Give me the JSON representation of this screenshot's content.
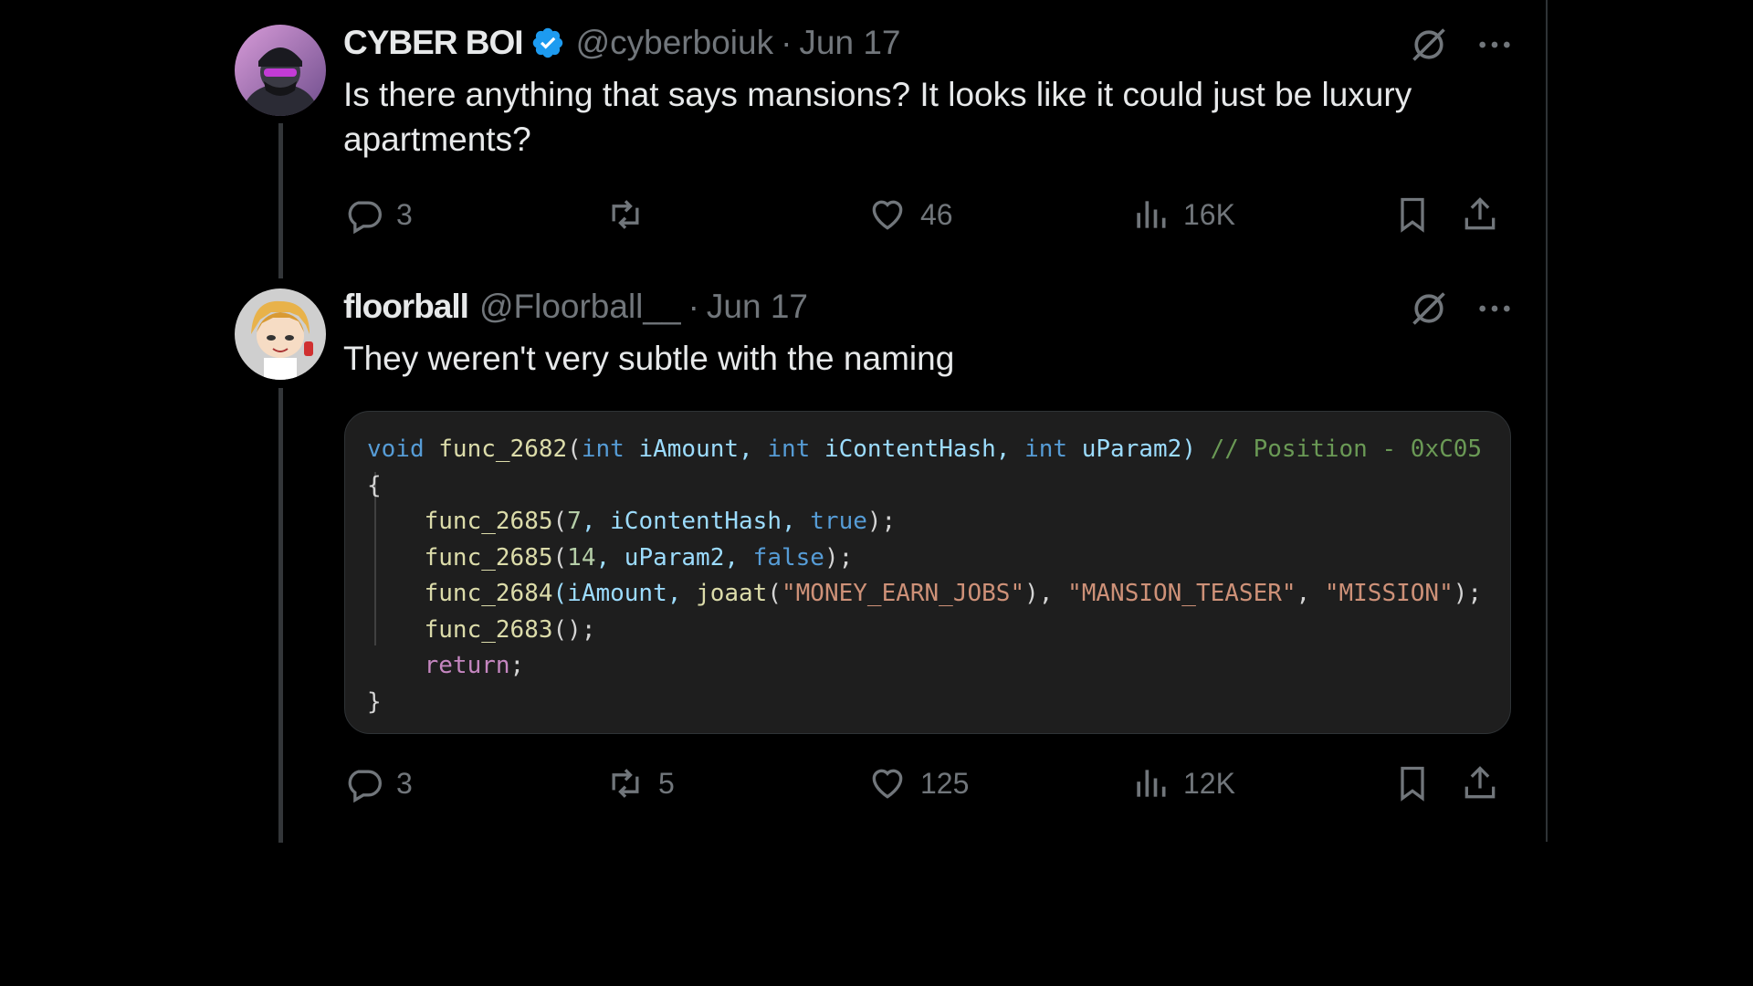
{
  "tweets": [
    {
      "name": "CYBER BOI",
      "handle": "@cyberboiuk",
      "separator": "·",
      "date": "Jun 17",
      "text": "Is there anything that says mansions? It looks like it could just be luxury apartments?",
      "replies": "3",
      "retweets": "",
      "likes": "46",
      "views": "16K",
      "verified": true
    },
    {
      "name": "floorball",
      "handle": "@Floorball__",
      "separator": "·",
      "date": "Jun 17",
      "text": "They weren't very subtle with the naming",
      "replies": "3",
      "retweets": "5",
      "likes": "125",
      "views": "12K",
      "verified": false,
      "code": {
        "l1": {
          "kw_void": "void",
          "fn": "func_2682",
          "p1": "(",
          "kw_int1": "int",
          "v1": " iAmount, ",
          "kw_int2": "int",
          "v2": " iContentHash, ",
          "kw_int3": "int",
          "v3": " uParam2) ",
          "comment": "// Position - 0xC05"
        },
        "l2": "{",
        "l3": {
          "fn": "func_2685",
          "a": "(",
          "n": "7",
          "b": ", iContentHash, ",
          "kw": "true",
          "c": ");"
        },
        "l4": {
          "fn": "func_2685",
          "a": "(",
          "n": "14",
          "b": ", uParam2, ",
          "kw": "false",
          "c": ");"
        },
        "l5": {
          "fn": "func_2684",
          "a": "(iAmount, ",
          "fn2": "joaat",
          "b": "(",
          "s1": "\"MONEY_EARN_JOBS\"",
          "c": "), ",
          "s2": "\"MANSION_TEASER\"",
          "d": ", ",
          "s3": "\"MISSION\"",
          "e": ");"
        },
        "l6": {
          "fn": "func_2683",
          "a": "();"
        },
        "l7": {
          "kw": "return",
          "a": ";"
        },
        "l8": "}"
      }
    }
  ],
  "icons": [
    "grok-icon",
    "more-icon",
    "reply-icon",
    "retweet-icon",
    "like-icon",
    "views-icon",
    "bookmark-icon",
    "share-icon",
    "verified-badge-icon"
  ],
  "colors": {
    "background": "#000000",
    "text": "#e7e9ea",
    "muted": "#71767b",
    "verified": "#1d9bf0",
    "code_bg": "#1e1e1e"
  }
}
